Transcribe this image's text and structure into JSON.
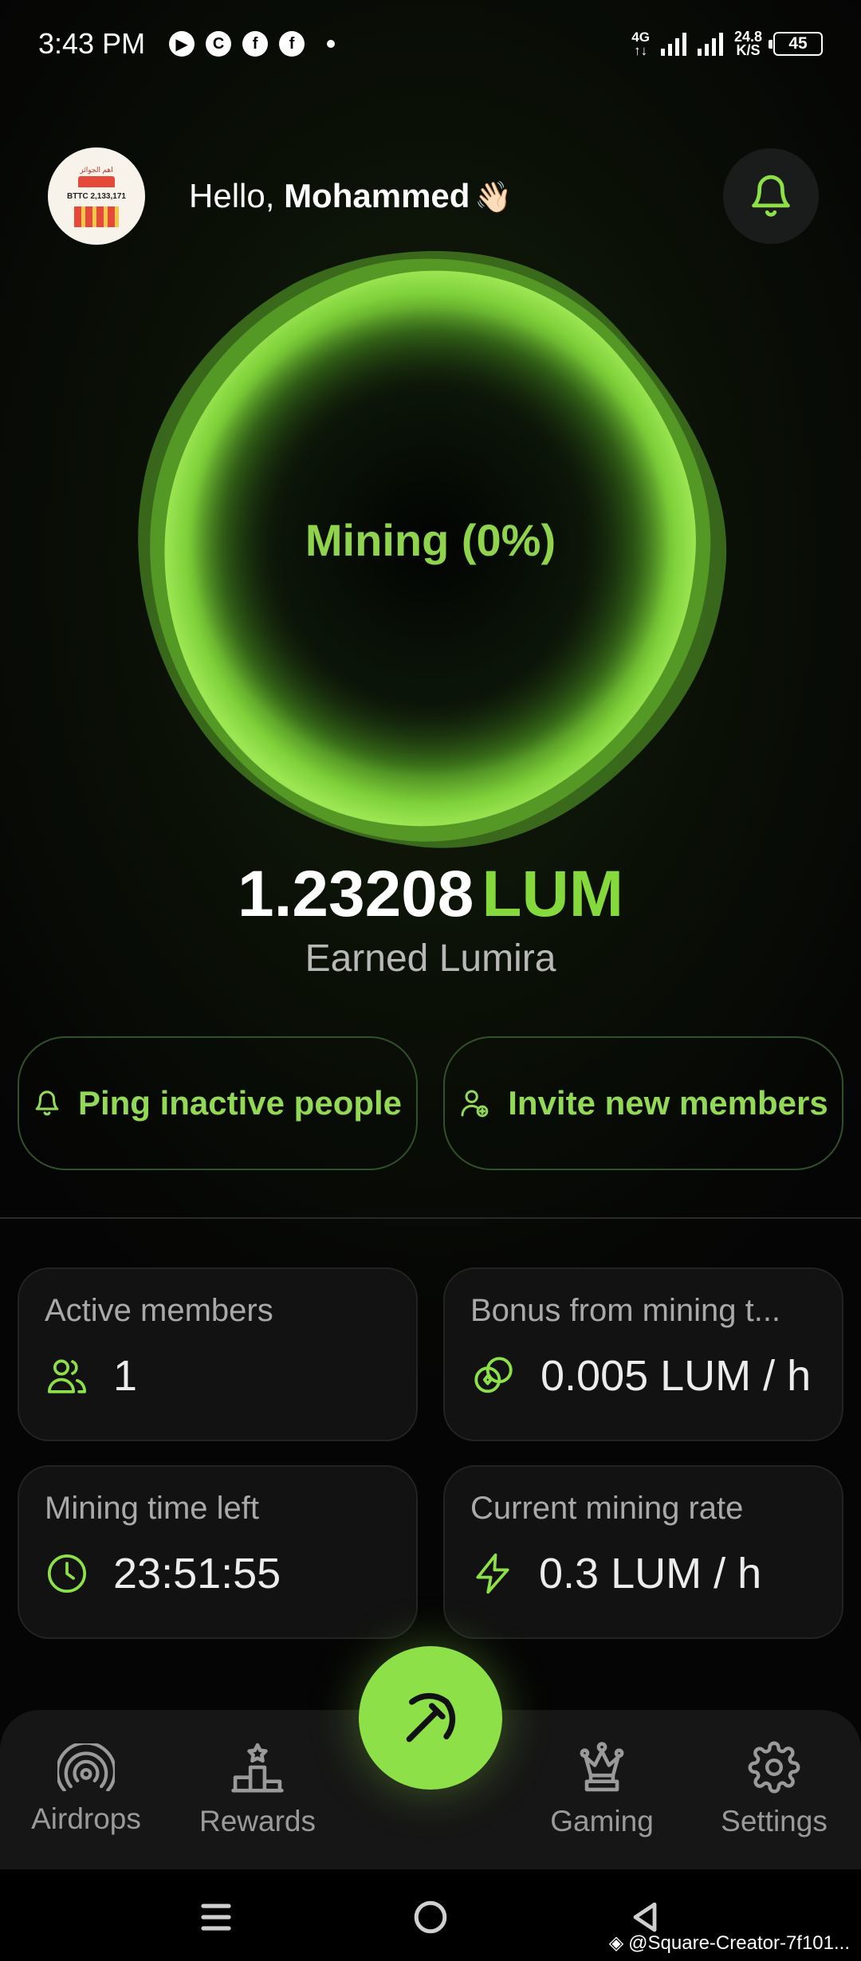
{
  "status_bar": {
    "time": "3:43 PM",
    "network": "4G",
    "speed_value": "24.8",
    "speed_unit": "K/S",
    "battery": "45"
  },
  "header": {
    "avatar_text": "BTTC 2,133,171",
    "greeting_prefix": "Hello, ",
    "user_name": "Mohammed",
    "wave_emoji": "👋🏻"
  },
  "mining": {
    "status_label": "Mining (0%)",
    "progress_percent": 0,
    "earned_amount": "1.23208",
    "earned_unit": "LUM",
    "earned_label": "Earned Lumira"
  },
  "actions": {
    "ping_label": "Ping inactive people",
    "invite_label": "Invite new members"
  },
  "stats": {
    "active_members": {
      "title": "Active members",
      "value": "1"
    },
    "bonus": {
      "title": "Bonus from mining t...",
      "value": "0.005 LUM / h"
    },
    "time_left": {
      "title": "Mining time left",
      "value": "23:51:55"
    },
    "rate": {
      "title": "Current mining rate",
      "value": "0.3 LUM / h"
    }
  },
  "nav": {
    "airdrops": "Airdrops",
    "rewards": "Rewards",
    "gaming": "Gaming",
    "settings": "Settings"
  },
  "watermark": "@Square-Creator-7f101...",
  "colors": {
    "accent": "#8ee048",
    "accent_text": "#93d856",
    "card_bg": "#121212",
    "nav_bg": "#161616"
  }
}
